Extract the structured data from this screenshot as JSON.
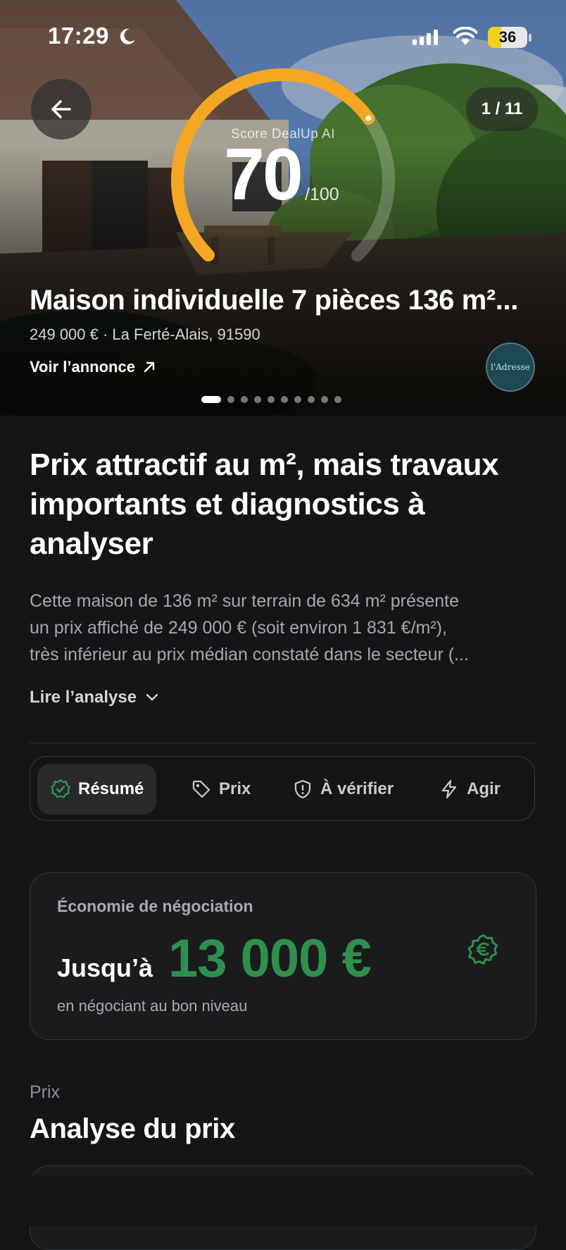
{
  "status_bar": {
    "time": "17:29",
    "battery": "36"
  },
  "hero": {
    "photo_counter": "1 / 11",
    "score_label": "Score DealUp AI",
    "score_value": "70",
    "score_max": "/100",
    "score_fraction": 0.7,
    "gauge_color": "#f5a623",
    "title": "Maison individuelle 7 pièces 136 m²...",
    "subtitle": "249 000 € · La Ferté-Alais, 91590",
    "link_label": "Voir l’annonce",
    "agency_logo_text": "l'Adresse",
    "pager": {
      "count": 10,
      "active_index": 0
    }
  },
  "analysis": {
    "headline": "Prix attractif au m², mais travaux importants et diagnostics à analyser",
    "summary_lines": [
      "Cette maison de 136 m² sur terrain de 634 m² présente",
      "un prix affiché de 249 000 € (soit environ 1 831 €/m²),",
      "très inférieur au prix médian constaté dans le secteur (..."
    ],
    "read_more": "Lire l’analyse"
  },
  "tabs": [
    {
      "label": "Résumé",
      "icon": "check-badge-icon",
      "active": true
    },
    {
      "label": "Prix",
      "icon": "tag-icon",
      "active": false
    },
    {
      "label": "À vérifier",
      "icon": "shield-alert-icon",
      "active": false
    },
    {
      "label": "Agir",
      "icon": "lightning-icon",
      "active": false
    }
  ],
  "negotiation": {
    "title": "Économie de négociation",
    "prefix": "Jusqu’à",
    "amount": "13 000 €",
    "subtitle": "en négociant au bon niveau",
    "accent_color": "#2f8f4e"
  },
  "price_section": {
    "eyebrow": "Prix",
    "title": "Analyse du prix"
  }
}
